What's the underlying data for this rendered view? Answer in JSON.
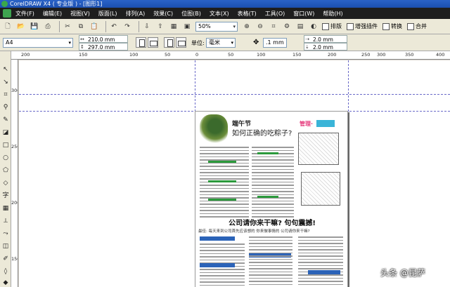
{
  "window": {
    "title": "CorelDRAW X4 ( 专业版 ) - [图形1]"
  },
  "menu": [
    "文件(F)",
    "编辑(E)",
    "视图(V)",
    "版面(L)",
    "排列(A)",
    "效果(C)",
    "位图(B)",
    "文本(X)",
    "表格(T)",
    "工具(O)",
    "窗口(W)",
    "帮助(H)"
  ],
  "toolbar": {
    "zoom": "50%",
    "buttons": [
      {
        "label": "排版",
        "icon": "layout-icon"
      },
      {
        "label": "增强插件",
        "icon": "plugin-icon"
      },
      {
        "label": "转换",
        "icon": "convert-icon"
      },
      {
        "label": "合并",
        "icon": "merge-icon"
      }
    ]
  },
  "property_bar": {
    "page_size": "A4",
    "width": "210.0 mm",
    "height": "297.0 mm",
    "units_label": "单位:",
    "units": "毫米",
    "nudge": ".1 mm",
    "dup_x": "2.0 mm",
    "dup_y": "2.0 mm"
  },
  "ruler_h_ticks": [
    "200",
    "150",
    "100",
    "50",
    "0",
    "50",
    "100",
    "150",
    "200",
    "250",
    "300",
    "350",
    "400"
  ],
  "ruler_v_ticks": [
    "300",
    "250",
    "200",
    "150"
  ],
  "document": {
    "heading1": "端午节",
    "heading2": "如何正确的吃粽子?",
    "badge": "管理·",
    "title": "公司请你来干嘛? 句句震撼!",
    "subtitle": "最佳: 每天来到公司首先应该想的 你来做事情的 公司请你来干嘛?"
  },
  "watermark": "头条 @昆萨"
}
